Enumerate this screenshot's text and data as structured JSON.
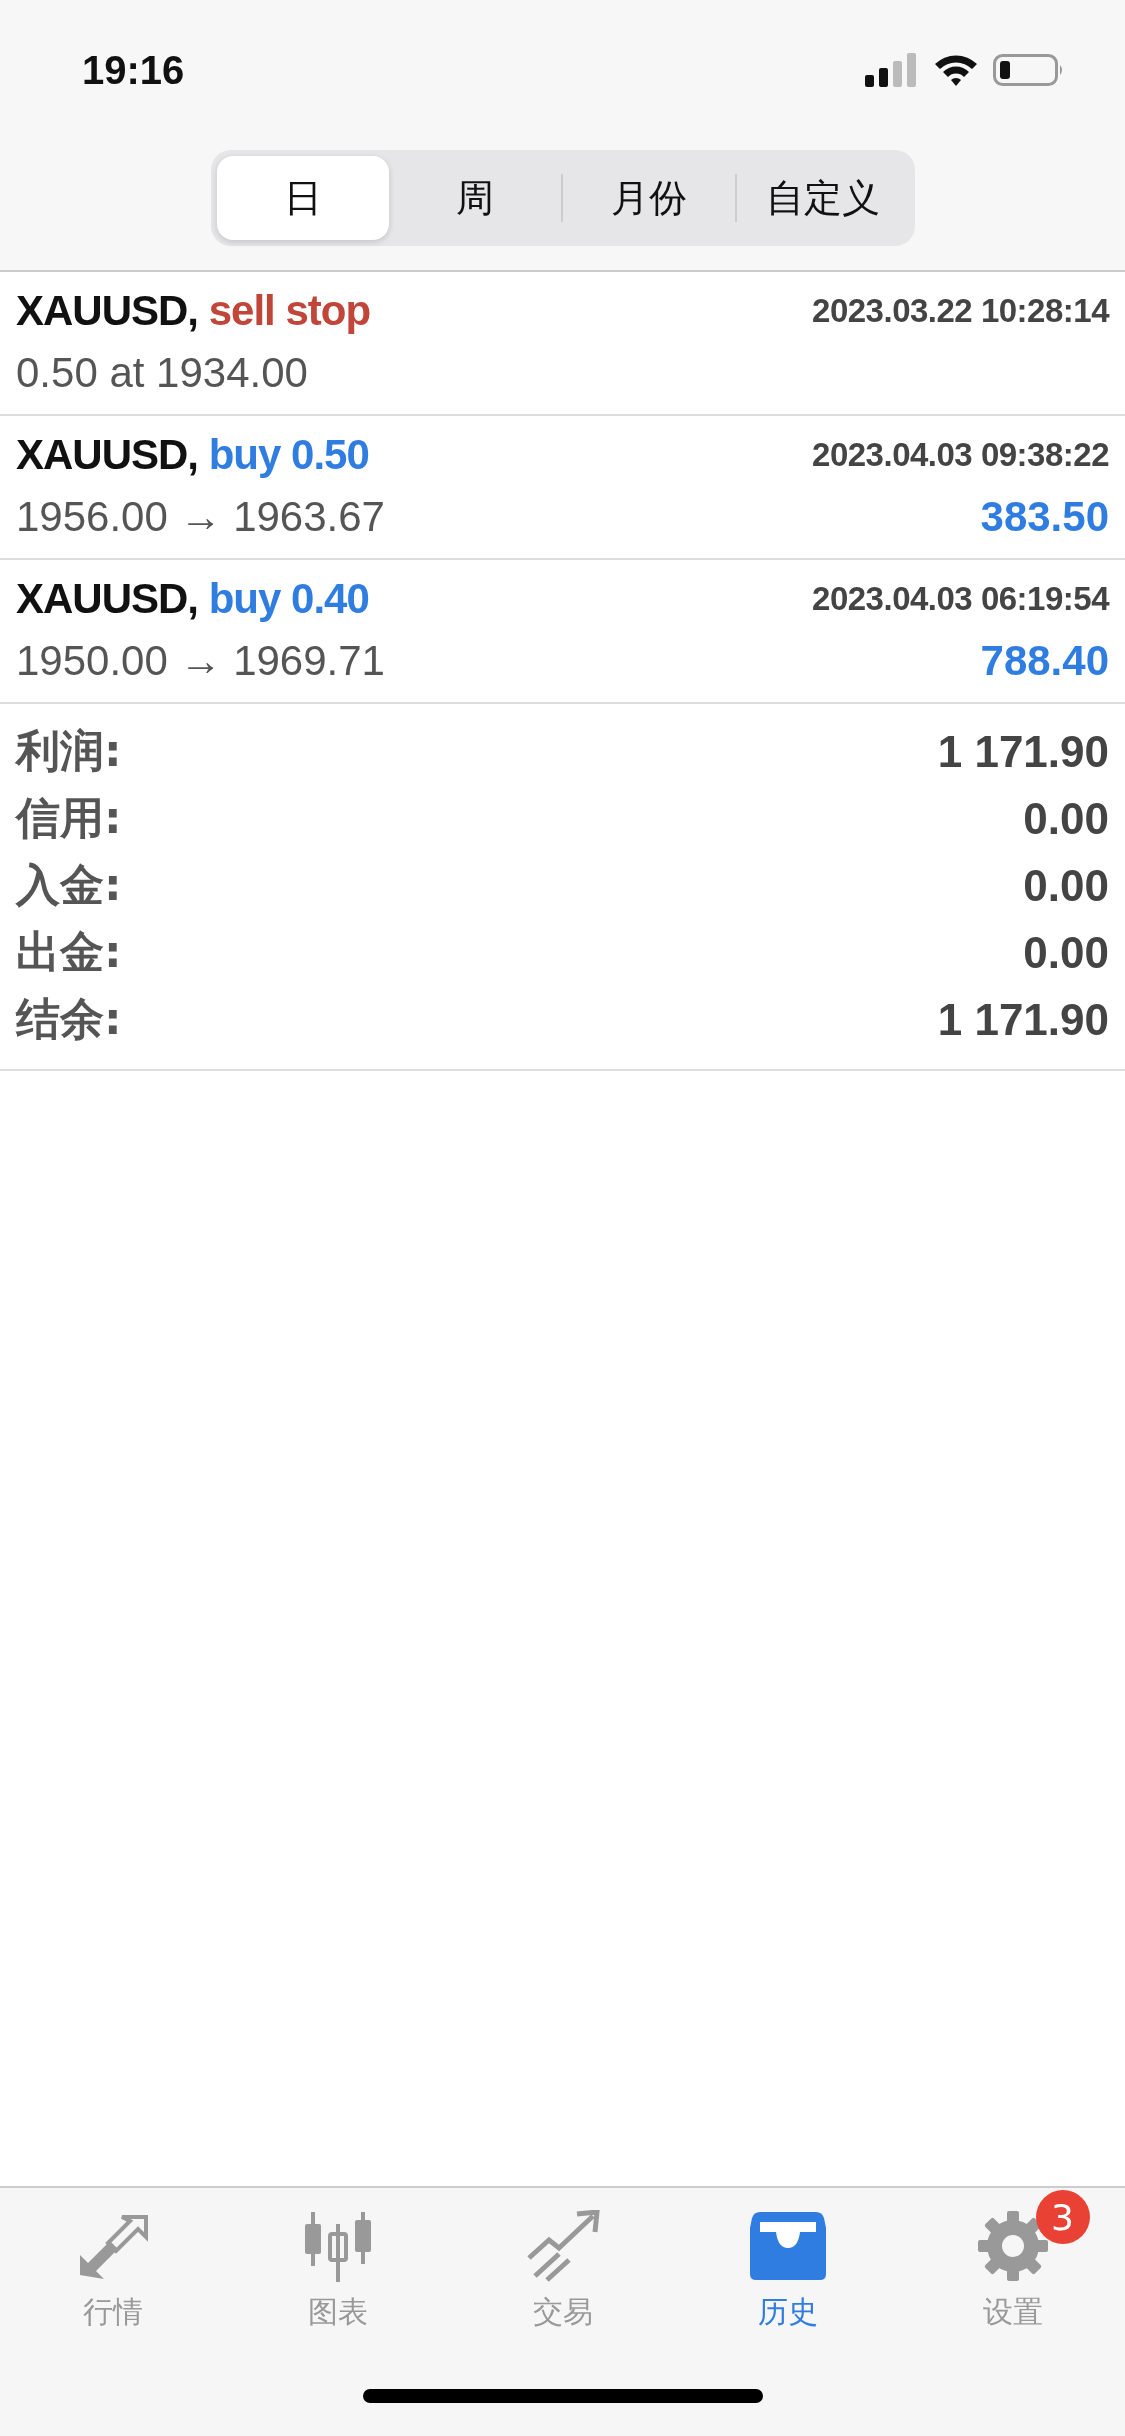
{
  "status_bar": {
    "time": "19:16"
  },
  "period_tabs": [
    {
      "label": "日",
      "selected": true
    },
    {
      "label": "周",
      "selected": false
    },
    {
      "label": "月份",
      "selected": false
    },
    {
      "label": "自定义",
      "selected": false
    }
  ],
  "orders": [
    {
      "symbol": "XAUUSD,",
      "action": "sell stop",
      "kind": "sell",
      "time": "2023.03.22 10:28:14",
      "detail": "0.50 at 1934.00"
    },
    {
      "symbol": "XAUUSD,",
      "action": "buy 0.50",
      "kind": "buy",
      "time": "2023.04.03 09:38:22",
      "detail": "1956.00 → 1963.67",
      "profit": "383.50"
    },
    {
      "symbol": "XAUUSD,",
      "action": "buy 0.40",
      "kind": "buy",
      "time": "2023.04.03 06:19:54",
      "detail": "1950.00 → 1969.71",
      "profit": "788.40"
    }
  ],
  "summary": [
    {
      "label": "利润:",
      "value": "1 171.90"
    },
    {
      "label": "信用:",
      "value": "0.00"
    },
    {
      "label": "入金:",
      "value": "0.00"
    },
    {
      "label": "出金:",
      "value": "0.00"
    },
    {
      "label": "结余:",
      "value": "1 171.90"
    }
  ],
  "tab_bar": [
    {
      "kind": "quotes",
      "label": "行情",
      "selected": false
    },
    {
      "kind": "chart",
      "label": "图表",
      "selected": false
    },
    {
      "kind": "trade",
      "label": "交易",
      "selected": false
    },
    {
      "kind": "history",
      "label": "历史",
      "selected": true
    },
    {
      "kind": "settings",
      "label": "设置",
      "selected": false,
      "badge": "3"
    }
  ]
}
